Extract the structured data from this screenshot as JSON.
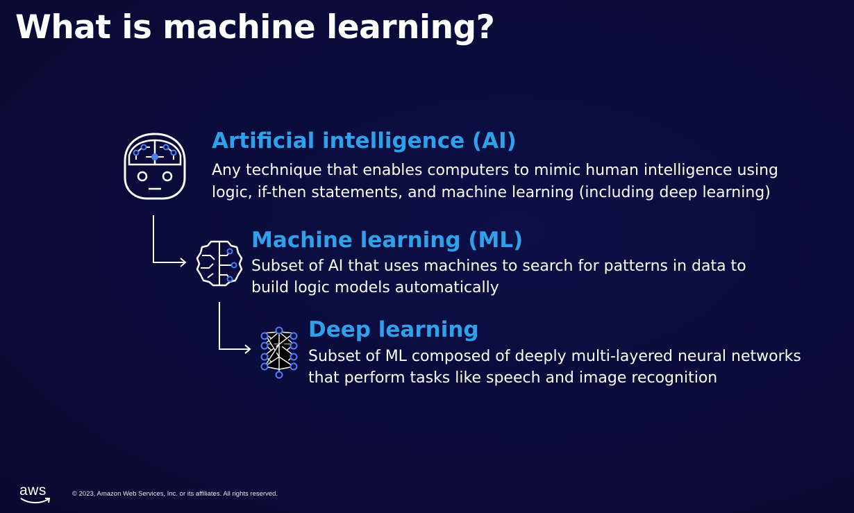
{
  "slide": {
    "title": "What is machine learning?",
    "colors": {
      "background": "#0a0b3a",
      "heading": "#2ea1ea",
      "text": "#ffffff",
      "icon_accent": "#4a7ff5"
    }
  },
  "items": [
    {
      "icon": "ai-head-icon",
      "heading": "Artificial intelligence (AI)",
      "description_lines": [
        "Any technique that enables computers to mimic human intelligence using",
        "logic, if-then statements, and machine learning (including deep learning)"
      ]
    },
    {
      "icon": "brain-circuit-icon",
      "heading": "Machine learning (ML)",
      "description_lines": [
        "Subset of AI that uses machines to search for patterns in data to",
        "build logic models automatically"
      ]
    },
    {
      "icon": "neural-network-icon",
      "heading": "Deep learning",
      "description_lines": [
        "Subset of ML composed of deeply multi-layered neural networks",
        "that perform tasks like speech and image recognition"
      ]
    }
  ],
  "footer": {
    "logo_text": "aws",
    "copyright": "© 2023, Amazon Web Services, Inc. or its affiliates. All rights reserved."
  }
}
